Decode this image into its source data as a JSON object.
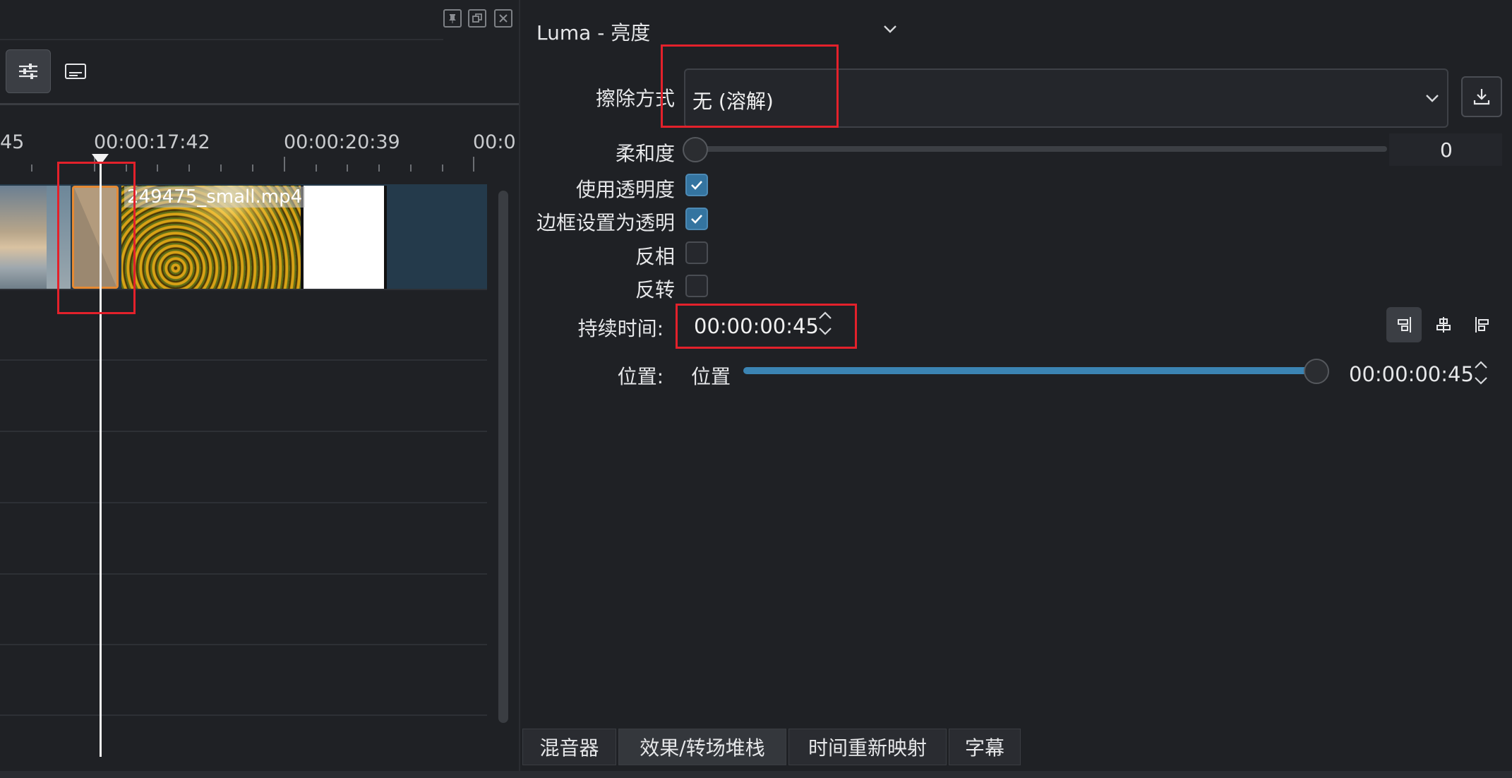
{
  "timeline": {
    "ruler_labels": [
      "45",
      "00:00:17:42",
      "00:00:20:39",
      "00:0"
    ],
    "clip_name": "249475_small.mp4"
  },
  "effect": {
    "title": "Luma - 亮度",
    "wipe_label": "擦除方式",
    "wipe_value": "无 (溶解)",
    "softness_label": "柔和度",
    "softness_value": "0",
    "checkboxes": [
      {
        "label": "使用透明度",
        "checked": true
      },
      {
        "label": "边框设置为透明",
        "checked": true
      },
      {
        "label": "反相",
        "checked": false
      },
      {
        "label": "反转",
        "checked": false
      }
    ],
    "duration_label": "持续时间:",
    "duration_value": "00:00:00:45",
    "position_label": "位置:",
    "position_sub_label": "位置",
    "position_value": "00:00:00:45",
    "position_fraction": 1.0
  },
  "tabs": [
    "混音器",
    "效果/转场堆栈",
    "时间重新映射",
    "字幕"
  ],
  "active_tab": 1,
  "colors": {
    "accent": "#3b84b3",
    "transition_border": "#e68a33",
    "highlight": "#e3212b"
  }
}
